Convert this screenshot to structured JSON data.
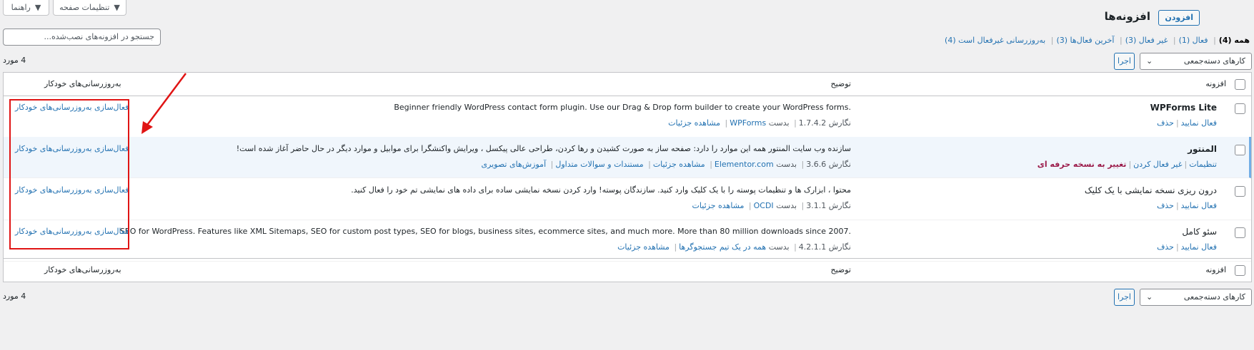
{
  "screen": {
    "help_label": "راهنما",
    "options_label": "تنظیمات صفحه"
  },
  "header": {
    "title": "افزونه‌ها",
    "add_new": "افزودن"
  },
  "search": {
    "placeholder": "جستجو در افزونه‌های نصب‌شده..."
  },
  "filters": {
    "all": "همه (4)",
    "active": "فعال (1)",
    "inactive": "غیر فعال (3)",
    "recent": "آخرین فعال‌ها (3)",
    "auto_disabled": "به‌روزرسانی غیرفعال است (4)"
  },
  "bulk": {
    "select_label": "کارهای دسته‌جمعی",
    "apply_label": "اجرا",
    "count": "4 مورد"
  },
  "columns": {
    "plugin": "افزونه",
    "description": "توضیح",
    "auto_updates": "به‌روزرسانی‌های خودکار"
  },
  "rows": [
    {
      "name": "WPForms Lite",
      "actions": [
        "فعال نمایید",
        "حذف"
      ],
      "description": "Beginner friendly WordPress contact form plugin. Use our Drag & Drop form builder to create your WordPress forms.",
      "version": "نگارش 1.7.4.2",
      "by": "بدست",
      "author": "WPForms",
      "links": [
        "مشاهده جزئیات"
      ],
      "auto": "فعال‌سازی به‌روزرسانی‌های خودکار"
    },
    {
      "name": "المنتور",
      "actions": [
        "تنظیمات",
        "غیر فعال کردن",
        "تغییر به نسخه حرفه ای"
      ],
      "description": "سازنده وب سایت المنتور همه این موارد را دارد: صفحه ساز به صورت کشیدن و رها کردن، طراحی عالی پیکسل ، ویرایش واکنشگرا برای موابیل و موارد دیگر در حال حاضر آغاز شده است!",
      "version": "نگارش 3.6.6",
      "by": "بدست",
      "author": "Elementor.com",
      "links": [
        "مشاهده جزئیات",
        "مستندات و سوالات متداول",
        "آموزش‌های تصویری"
      ],
      "auto": "فعال‌سازی به‌روزرسانی‌های خودکار"
    },
    {
      "name": "درون ریزی نسخه نمایشی با یک کلیک",
      "actions": [
        "فعال نمایید",
        "حذف"
      ],
      "description": "محتوا ، ابزارک ها و تنظیمات پوسته را با یک کلیک وارد کنید. سازندگان پوسته! وارد کردن نسخه نمایشی ساده برای داده های نمایشی تم خود را فعال کنید.",
      "version": "نگارش 3.1.1",
      "by": "بدست",
      "author": "OCDI",
      "links": [
        "مشاهده جزئیات"
      ],
      "auto": "فعال‌سازی به‌روزرسانی‌های خودکار"
    },
    {
      "name": "سئو کامل",
      "actions": [
        "فعال نمایید",
        "حذف"
      ],
      "description": "SEO for WordPress. Features like XML Sitemaps, SEO for custom post types, SEO for blogs, business sites, ecommerce sites, and much more. More than 80 million downloads since 2007.",
      "version": "نگارش 4.2.1.1",
      "by": "بدست",
      "author": "همه در یک تیم جستجوگرها",
      "links": [
        "مشاهده جزئیات"
      ],
      "auto": "فعال‌سازی به‌روزرسانی‌های خودکار"
    }
  ],
  "colors": {
    "link": "#2271b1",
    "annotation": "#e01414",
    "active_row": "#f0f6fc",
    "upgrade": "#9b1b4a"
  }
}
